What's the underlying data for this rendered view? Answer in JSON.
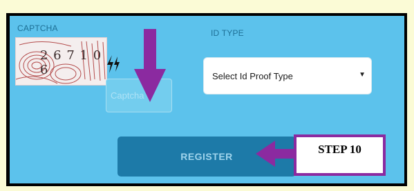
{
  "labels": {
    "captcha": "CAPTCHA",
    "id_type": "ID TYPE"
  },
  "captcha": {
    "code_text": "2 6 7 1 0 6",
    "input_placeholder": "Captcha"
  },
  "id_select": {
    "selected": "Select Id Proof Type"
  },
  "register": {
    "label": "REGISTER"
  },
  "annotation": {
    "step_label": "STEP 10",
    "arrow_color": "#8b2aa0"
  },
  "colors": {
    "panel": "#5cc2ec",
    "button": "#1d7aa8",
    "page_bg": "#fbfbd6"
  }
}
